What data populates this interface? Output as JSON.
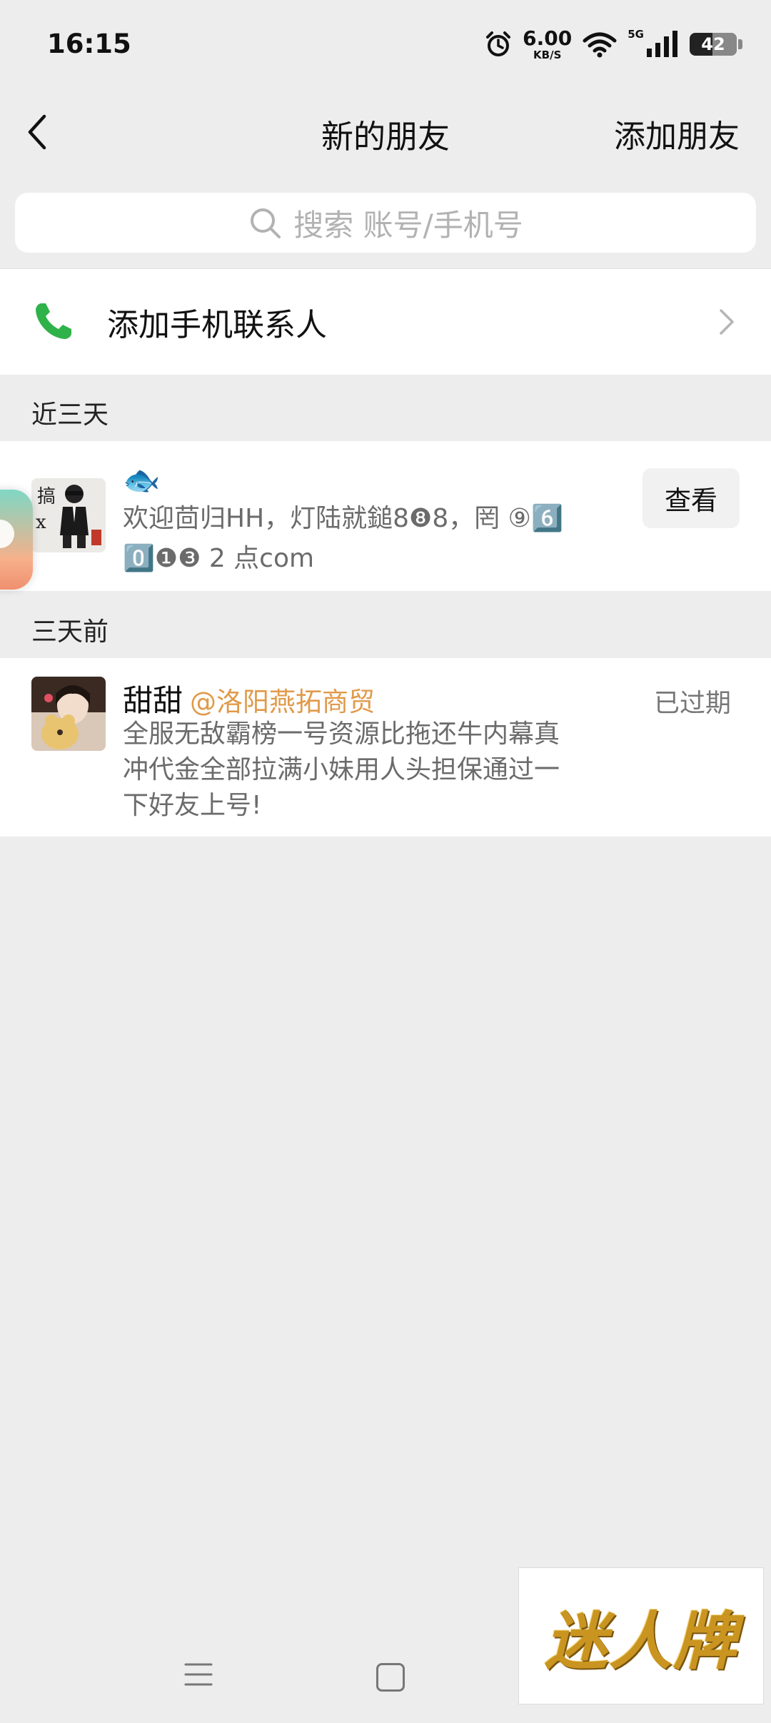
{
  "status_bar": {
    "time": "16:15",
    "speed_value": "6.00",
    "speed_unit": "KB/S",
    "network": "5G",
    "battery": "42"
  },
  "nav": {
    "title": "新的朋友",
    "add_friend": "添加朋友"
  },
  "search": {
    "placeholder": "搜索 账号/手机号"
  },
  "phone_contacts": {
    "label": "添加手机联系人"
  },
  "sections": [
    {
      "label": "近三天",
      "items": [
        {
          "name": "🐟",
          "message_line1": "欢迎茴归HH，灯陆就鎚8❽8，罔 ⑨6️⃣",
          "message_line2": "0️⃣❶❸ 2 点com",
          "action": "查看"
        }
      ]
    },
    {
      "label": "三天前",
      "items": [
        {
          "name": "甜甜",
          "remark": "@洛阳燕拓商贸",
          "message_line1": "全服无敌霸榜一号资源比拖还牛内幕真",
          "message_line2": "冲代金全部拉满小妹用人头担保通过一",
          "message_line3": "下好友上号!",
          "status": "已过期"
        }
      ]
    }
  ],
  "watermark": "迷人牌",
  "colors": {
    "background": "#ededed",
    "phone_icon": "#2fb24a",
    "remark": "#e09a4a",
    "watermark": "#c99520"
  }
}
